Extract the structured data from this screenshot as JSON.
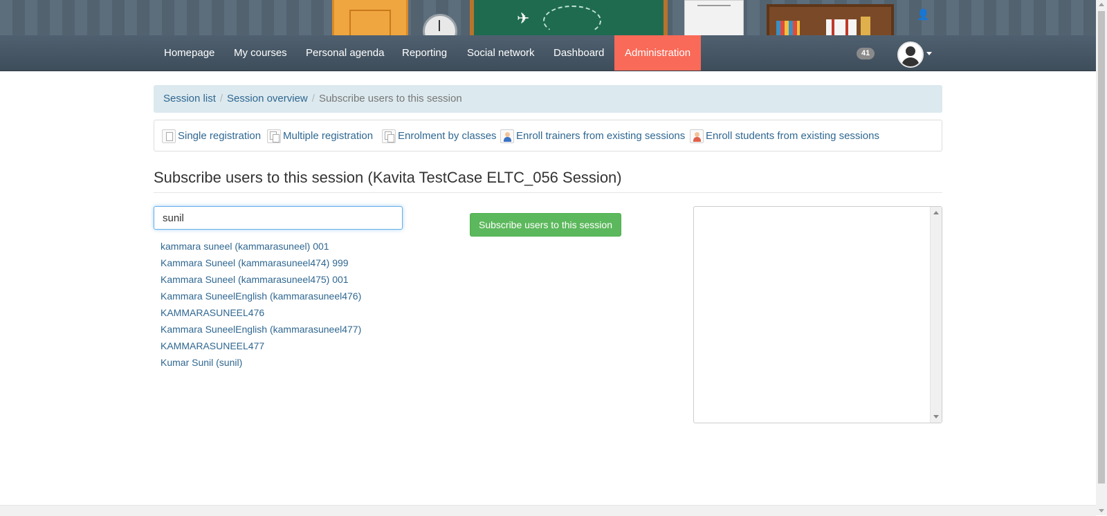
{
  "navbar": {
    "items": [
      "Homepage",
      "My courses",
      "Personal agenda",
      "Reporting",
      "Social network",
      "Dashboard",
      "Administration"
    ],
    "active_index": 6,
    "notification_count": "41",
    "active_color": "#f96a58"
  },
  "breadcrumb": {
    "items": [
      "Session list",
      "Session overview"
    ],
    "current": "Subscribe users to this session"
  },
  "actions": [
    {
      "label": "Single registration",
      "icon": "single-document-icon"
    },
    {
      "label": "Multiple registration",
      "icon": "multiple-documents-icon"
    },
    {
      "label": "Enrolment by classes",
      "icon": "multiple-documents-icon"
    },
    {
      "label": "Enroll trainers from existing sessions",
      "icon": "trainer-user-icon"
    },
    {
      "label": "Enroll students from existing sessions",
      "icon": "student-user-icon"
    }
  ],
  "page": {
    "title": "Subscribe users to this session (Kavita TestCase ELTC_056 Session)"
  },
  "search": {
    "value": "sunil"
  },
  "results": [
    "kammara suneel (kammarasuneel) 001",
    "Kammara Suneel (kammarasuneel474) 999",
    "Kammara Suneel (kammarasuneel475) 001",
    "Kammara SuneelEnglish (kammarasuneel476)",
    "KAMMARASUNEEL476",
    "Kammara SuneelEnglish (kammarasuneel477)",
    "KAMMARASUNEEL477",
    "Kumar Sunil (sunil)"
  ],
  "subscribe_button": {
    "label": "Subscribe users to this session",
    "color": "#5cb85c"
  }
}
